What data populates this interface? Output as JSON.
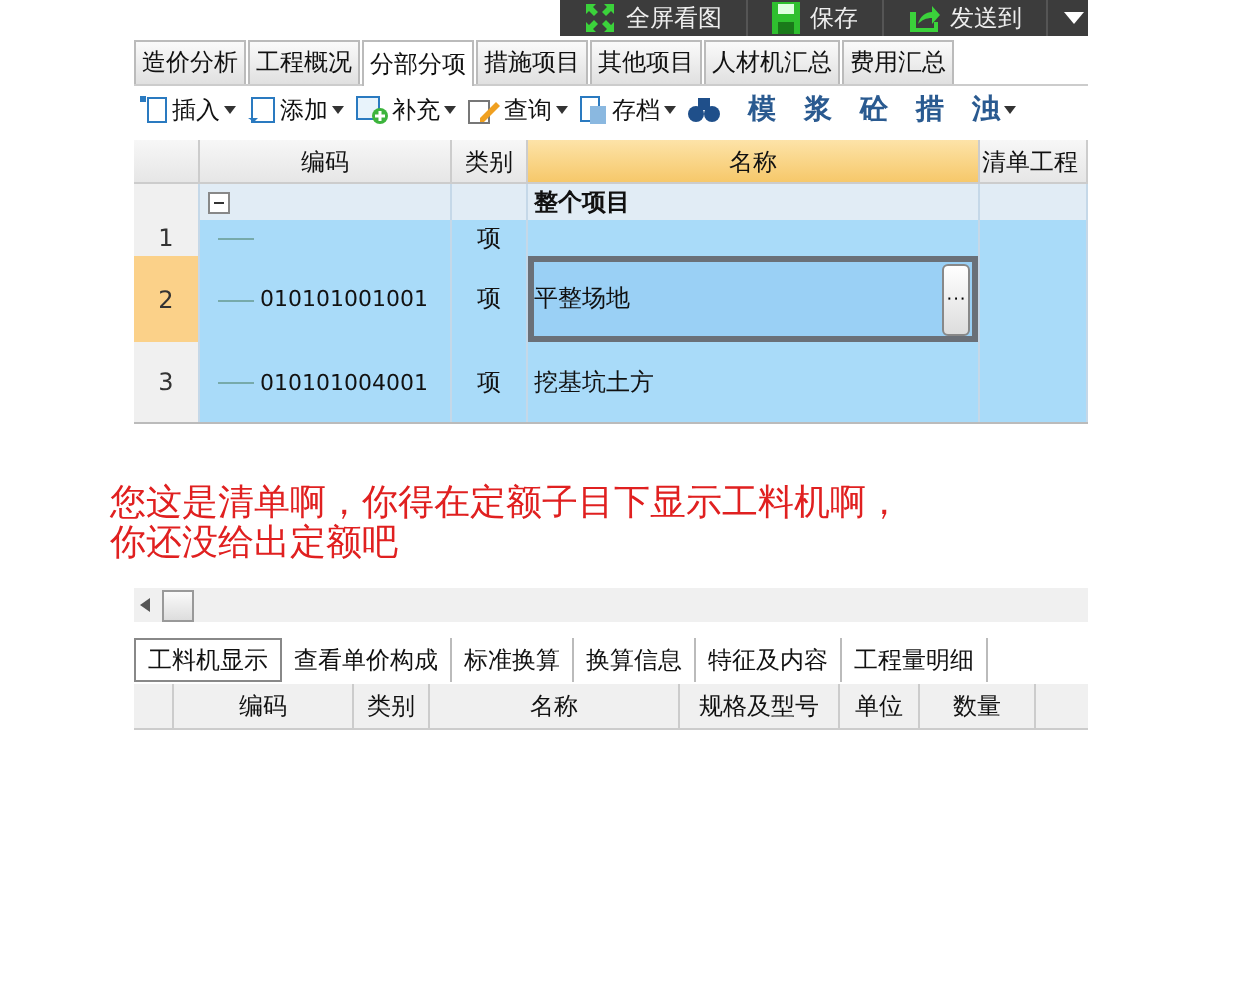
{
  "top_bar": {
    "buttons": [
      {
        "label": "全屏看图",
        "kind": "fullscreen"
      },
      {
        "label": "保存",
        "kind": "save"
      },
      {
        "label": "发送到",
        "kind": "send"
      }
    ]
  },
  "tabs": [
    {
      "label": "造价分析",
      "selected": false
    },
    {
      "label": "工程概况",
      "selected": false
    },
    {
      "label": "分部分项",
      "selected": true
    },
    {
      "label": "措施项目",
      "selected": false
    },
    {
      "label": "其他项目",
      "selected": false
    },
    {
      "label": "人材机汇总",
      "selected": false
    },
    {
      "label": "费用汇总",
      "selected": false
    }
  ],
  "toolbar": [
    {
      "label": "插入",
      "kind": "insert",
      "dropdown": true
    },
    {
      "label": "添加",
      "kind": "add",
      "dropdown": true
    },
    {
      "label": "补充",
      "kind": "supplement",
      "dropdown": true
    },
    {
      "label": "查询",
      "kind": "query",
      "dropdown": true
    },
    {
      "label": "存档",
      "kind": "archive",
      "dropdown": true
    },
    {
      "kind": "binoculars",
      "dropdown": false
    },
    {
      "label": "模",
      "kind": "glyph",
      "dropdown": false
    },
    {
      "label": "浆",
      "kind": "glyph",
      "dropdown": false
    },
    {
      "label": "砼",
      "kind": "glyph",
      "dropdown": false
    },
    {
      "label": "措",
      "kind": "glyph",
      "dropdown": false
    },
    {
      "label": "浊",
      "kind": "glyph",
      "dropdown": true
    }
  ],
  "table": {
    "columns": [
      {
        "selected": false
      },
      {
        "label": "编码",
        "selected": false
      },
      {
        "label": "类别",
        "selected": false
      },
      {
        "label": "名称",
        "selected": true
      },
      {
        "label": "清单工程",
        "selected": false
      }
    ],
    "group": {
      "name": "整个项目",
      "expanded": true
    },
    "edit_button": "···",
    "rows": [
      {
        "index": "1",
        "code": "",
        "type": "项",
        "name": "",
        "selected": false
      },
      {
        "index": "2",
        "code": "010101001001",
        "type": "项",
        "name": "平整场地",
        "selected": true
      },
      {
        "index": "3",
        "code": "010101004001",
        "type": "项",
        "name": "挖基坑土方",
        "selected": false
      }
    ]
  },
  "comment": "您这是清单啊，你得在定额子目下显示工料机啊，你还没给出定额吧",
  "bottom_tabs": [
    {
      "label": "工料机显示",
      "selected": true
    },
    {
      "label": "查看单价构成",
      "selected": false
    },
    {
      "label": "标准换算",
      "selected": false
    },
    {
      "label": "换算信息",
      "selected": false
    },
    {
      "label": "特征及内容",
      "selected": false
    },
    {
      "label": "工程量明细",
      "selected": false
    }
  ],
  "bottom_columns": [
    "编码",
    "类别",
    "名称",
    "规格及型号",
    "单位",
    "数量"
  ]
}
